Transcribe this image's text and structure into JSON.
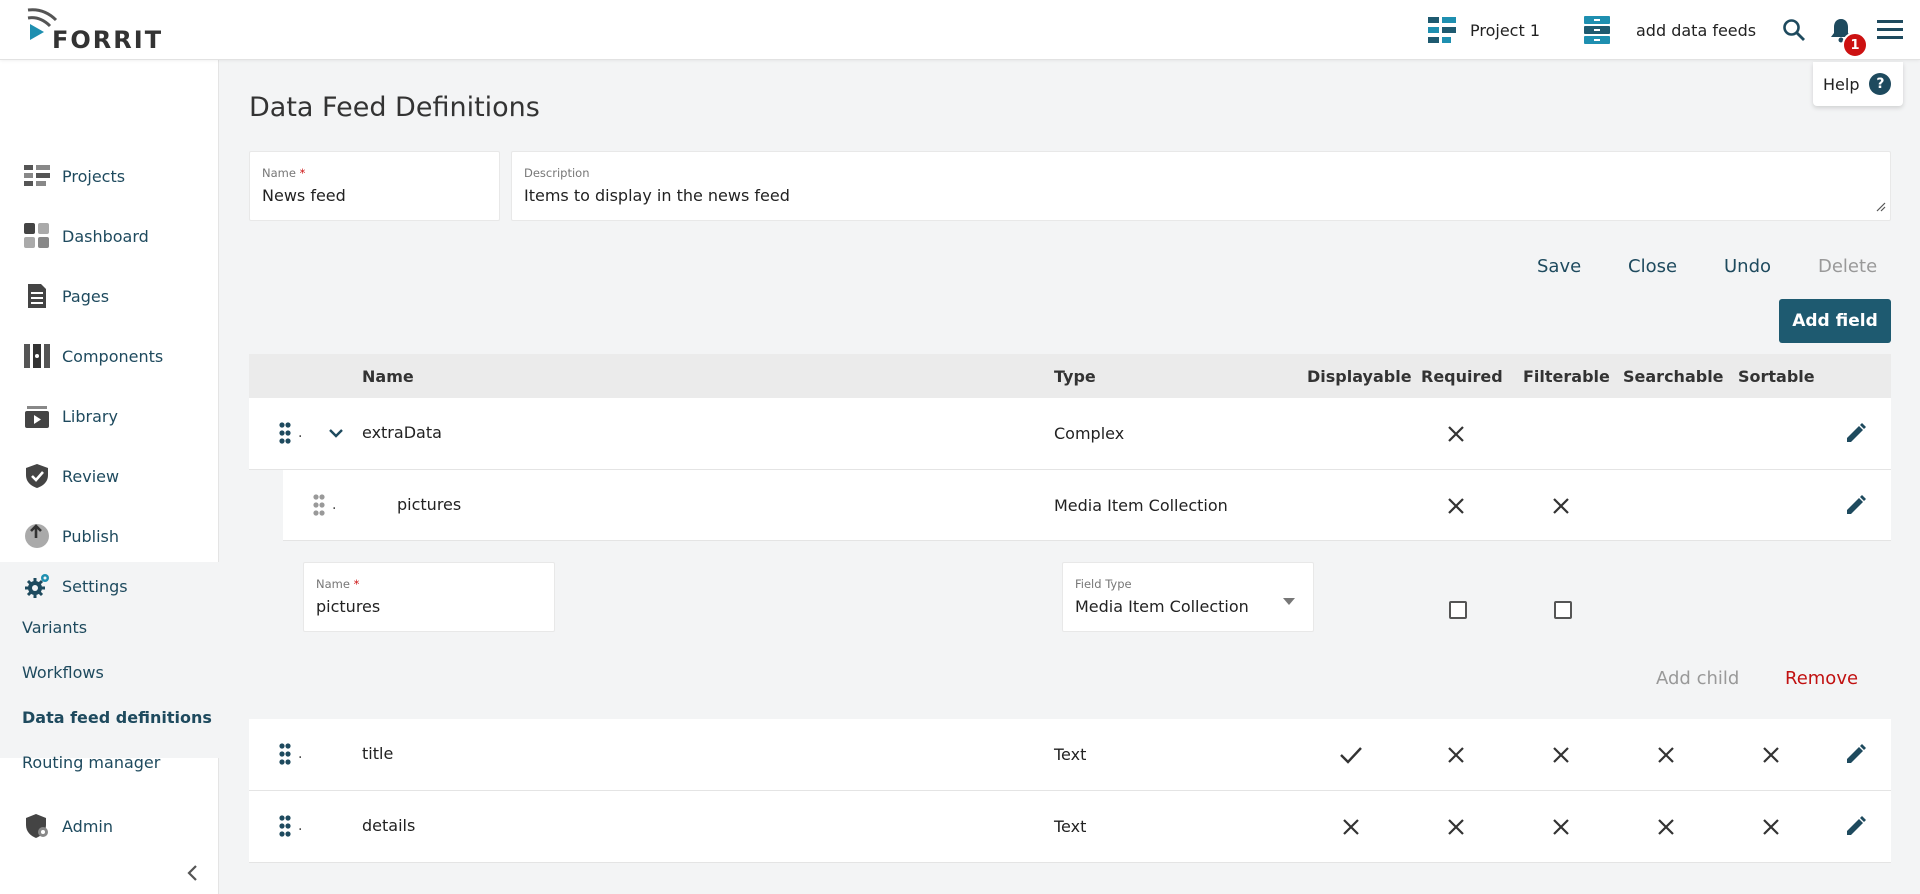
{
  "topbar": {
    "logo_text": "FORRIT",
    "project_label": "Project 1",
    "task_label": "add data feeds",
    "notification_count": "1"
  },
  "help": {
    "label": "Help",
    "symbol": "?"
  },
  "sidebar": {
    "items": [
      {
        "label": "Projects",
        "icon": "projects-icon"
      },
      {
        "label": "Dashboard",
        "icon": "dashboard-icon"
      },
      {
        "label": "Pages",
        "icon": "pages-icon"
      },
      {
        "label": "Components",
        "icon": "components-icon"
      },
      {
        "label": "Library",
        "icon": "library-icon"
      },
      {
        "label": "Review",
        "icon": "review-icon"
      },
      {
        "label": "Publish",
        "icon": "publish-icon"
      }
    ],
    "settings": {
      "label": "Settings",
      "sub_items": [
        "Variants",
        "Workflows",
        "Data feed definitions",
        "Routing manager"
      ],
      "active": "Data feed definitions"
    },
    "admin_label": "Admin"
  },
  "main": {
    "title": "Data Feed Definitions",
    "name_field": {
      "label": "Name",
      "required_mark": "*",
      "value": "News feed"
    },
    "description_field": {
      "label": "Description",
      "value": "Items to display in the news feed"
    },
    "actions": {
      "save": "Save",
      "close": "Close",
      "undo": "Undo",
      "delete": "Delete"
    },
    "add_field_label": "Add field"
  },
  "table": {
    "columns": [
      "Name",
      "Type",
      "Displayable",
      "Required",
      "Filterable",
      "Searchable",
      "Sortable"
    ],
    "rows": [
      {
        "name": "extraData",
        "type": "Complex",
        "displayable": "",
        "required": "x",
        "filterable": "",
        "searchable": "",
        "sortable": ""
      },
      {
        "name": "pictures",
        "type": "Media Item Collection",
        "displayable": "",
        "required": "x",
        "filterable": "x",
        "searchable": "",
        "sortable": ""
      },
      {
        "name": "title",
        "type": "Text",
        "displayable": "check",
        "required": "x",
        "filterable": "x",
        "searchable": "x",
        "sortable": "x"
      },
      {
        "name": "details",
        "type": "Text",
        "displayable": "x",
        "required": "x",
        "filterable": "x",
        "searchable": "x",
        "sortable": "x"
      }
    ],
    "drag_dot": ".",
    "editor": {
      "name_label": "Name",
      "name_required": "*",
      "name_value": "pictures",
      "type_label": "Field Type",
      "type_value": "Media Item Collection",
      "add_child": "Add child",
      "remove": "Remove"
    }
  },
  "colors": {
    "accent": "#1e5a70",
    "link": "#1e4a5e",
    "danger": "#c11111",
    "badge": "#cc1111"
  }
}
